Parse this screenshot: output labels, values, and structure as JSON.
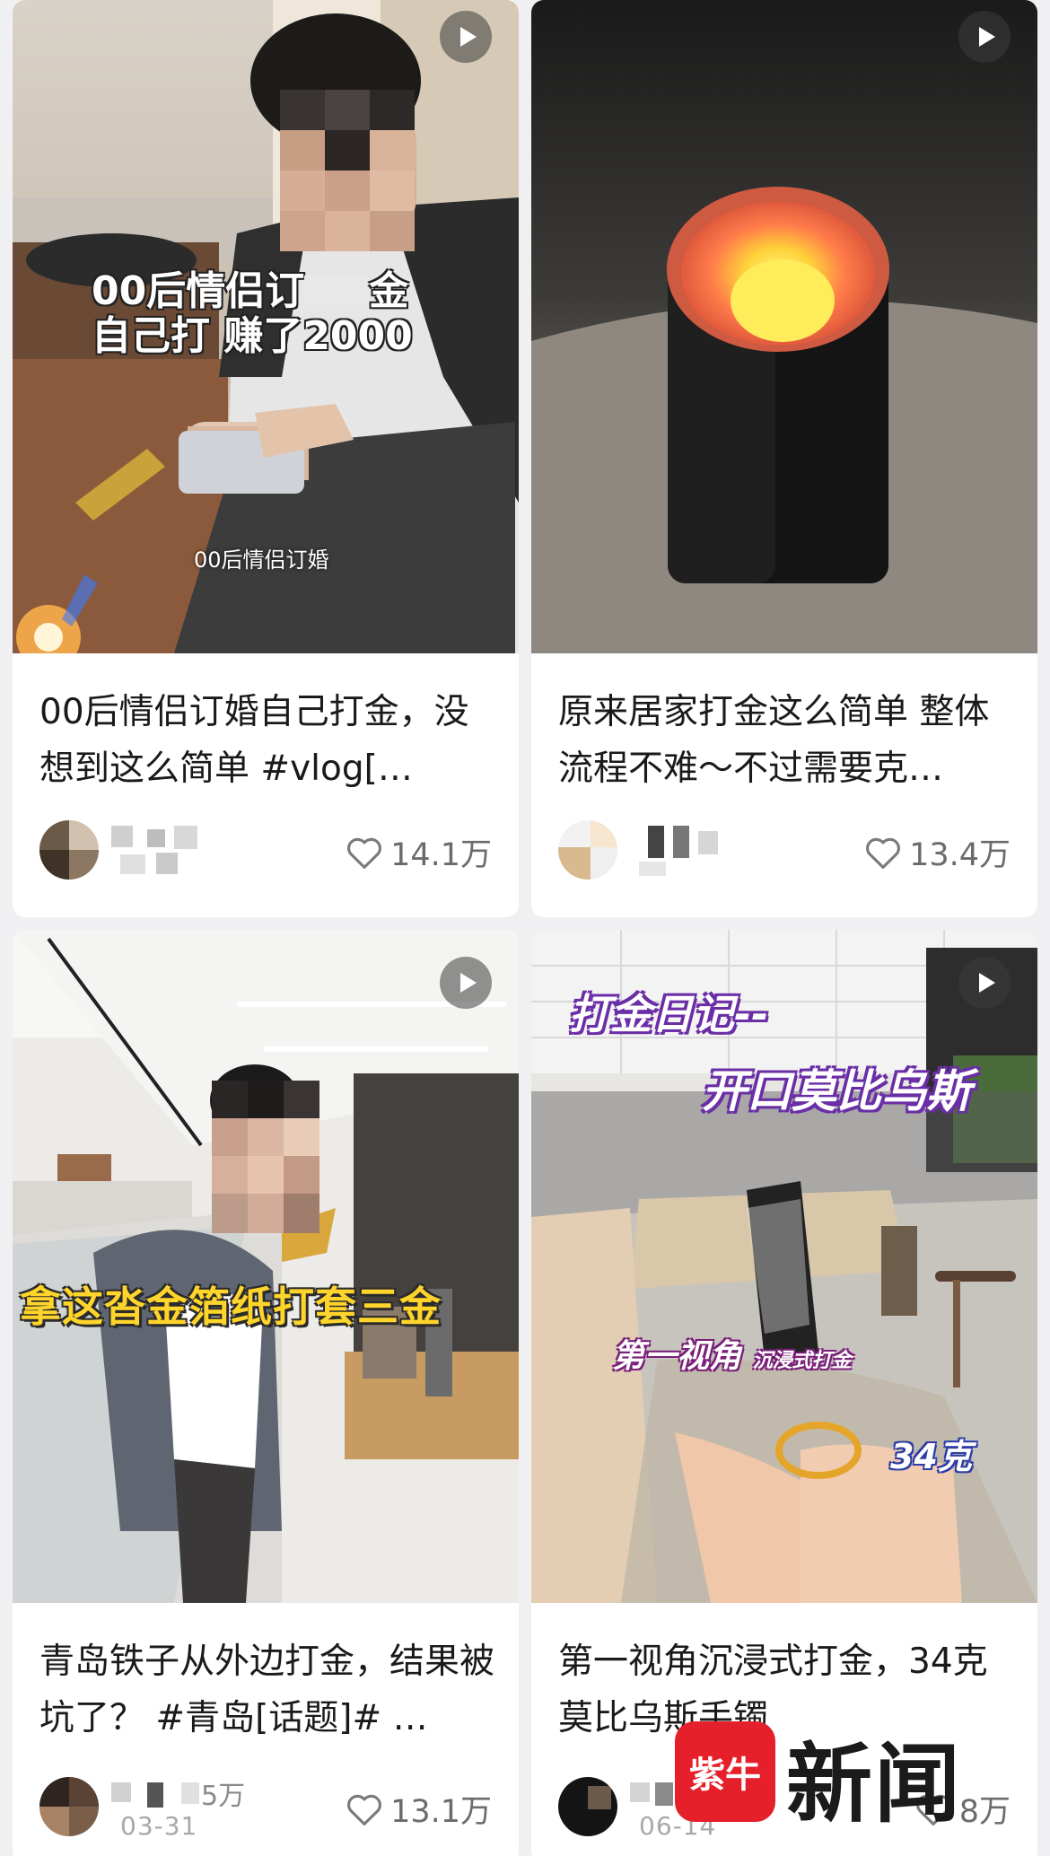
{
  "feed": {
    "cards": [
      {
        "overlay_line1": "00后情侣订",
        "overlay_line1_end": "金",
        "overlay_line2": "自己打  赚了2000",
        "caption": "00后情侣订婚",
        "title": "00后情侣订婚自己打金，没想到这么简单 #vlog[…",
        "likes": "14.1万"
      },
      {
        "title": "原来居家打金这么简单 整体流程不难～不过需要克…",
        "likes": "13.4万"
      },
      {
        "overlay_text": "拿这沓金箔纸打套三金",
        "title": "青岛铁子从外边打金，结果被坑了？ #青岛[话题]# …",
        "author_likes_partial": "5万",
        "date": "03-31",
        "likes": "13.1万"
      },
      {
        "overlay_line1": "打金日记--",
        "overlay_line2": "开口莫比乌斯",
        "overlay_tag_main": "第一视角",
        "overlay_tag_sub": "沉浸式打金",
        "overlay_weight": "34克",
        "title": "第一视角沉浸式打金，34克莫比乌斯手镯",
        "date": "06-14",
        "likes": "8万"
      }
    ]
  },
  "watermark": {
    "mark": "紫牛",
    "text": "新闻"
  },
  "colors": {
    "accent_red": "#e5202a",
    "text_primary": "#1a1a1a",
    "text_secondary": "#6b6b6b"
  },
  "icons": {
    "play": "play-icon",
    "like": "heart-outline-icon"
  }
}
